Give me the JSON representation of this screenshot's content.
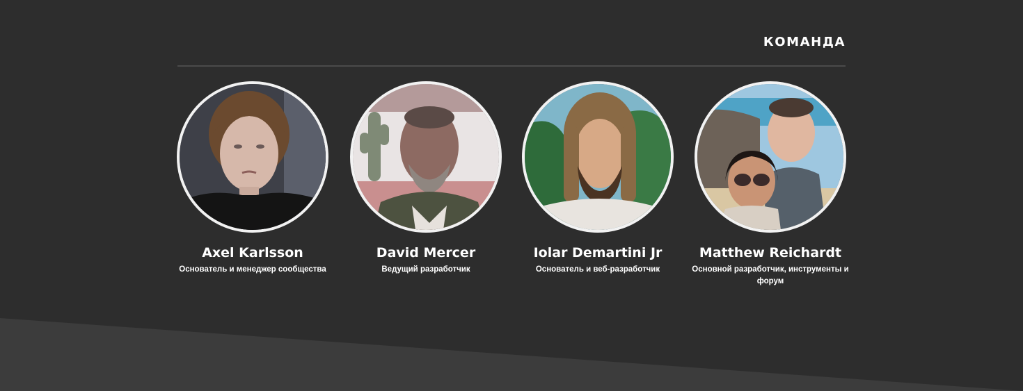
{
  "section": {
    "title": "КОМАНДА"
  },
  "members": [
    {
      "name": "Axel Karlsson",
      "role": "Основатель и менеджер сообщества",
      "photo": "portrait-photo"
    },
    {
      "name": "David Mercer",
      "role": "Ведущий разработчик",
      "photo": "portrait-photo"
    },
    {
      "name": "Iolar Demartini Jr",
      "role": "Основатель и веб-разработчик",
      "photo": "portrait-photo"
    },
    {
      "name": "Matthew Reichardt",
      "role": "Основной разработчик, инструменты и форум",
      "photo": "portrait-photo"
    }
  ],
  "colors": {
    "background": "#2d2d2d",
    "bottom_band": "#3c3c3c",
    "divider": "#4a4a4a",
    "avatar_border": "#f2f2f2",
    "text": "#ffffff"
  }
}
